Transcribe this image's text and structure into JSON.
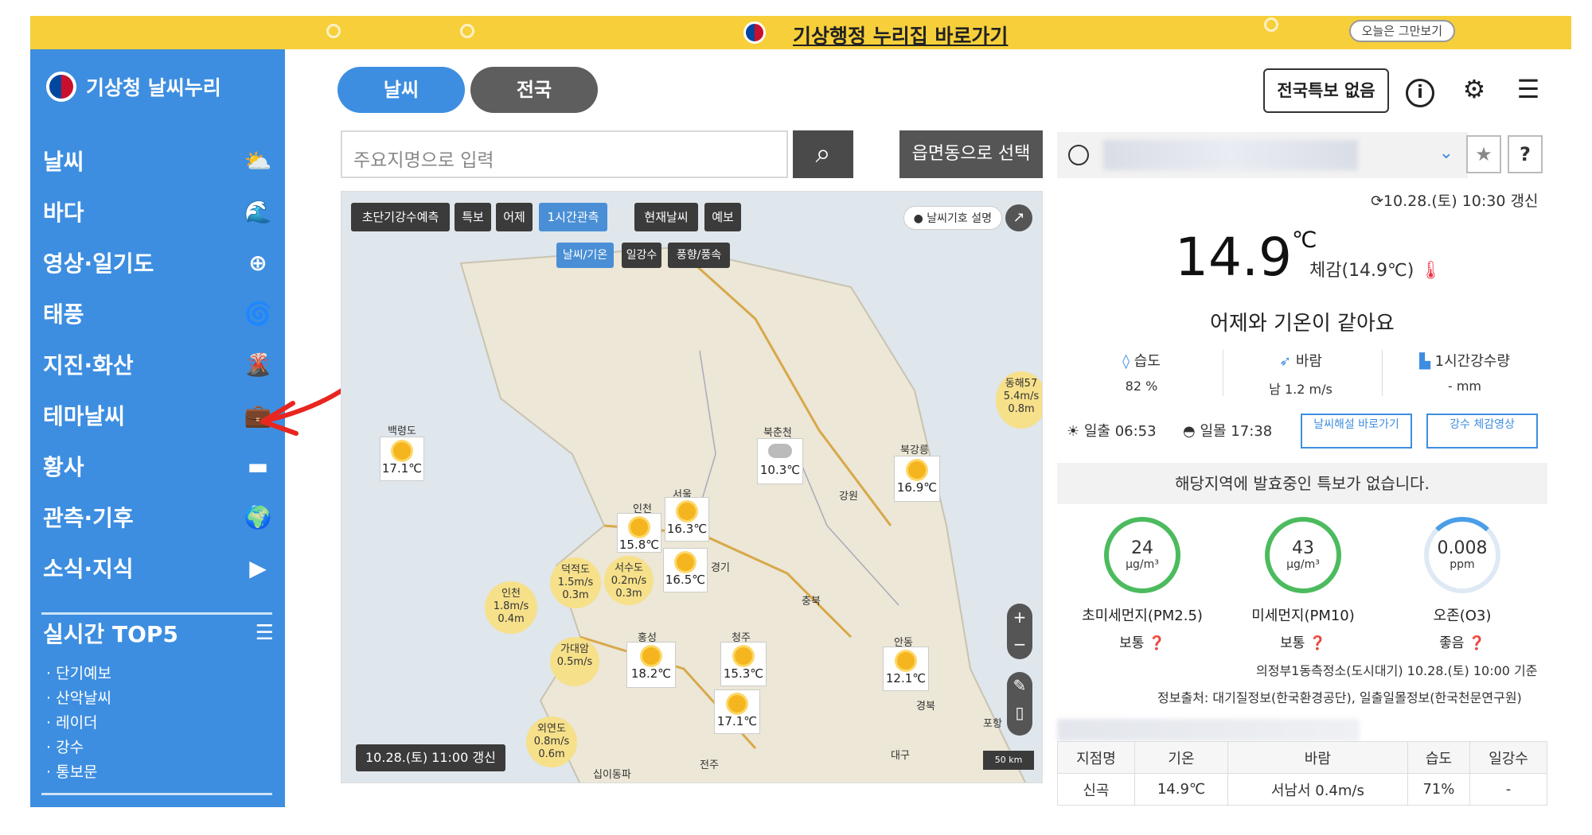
{
  "banner": {
    "title": "기상행정 누리집 바로가기",
    "hide_today": "오늘은 그만보기"
  },
  "sidebar": {
    "brand": "기상청 날씨누리",
    "items": [
      {
        "label": "날씨",
        "icon": "weather-icon",
        "glyph": "⛅"
      },
      {
        "label": "바다",
        "icon": "wave-icon",
        "glyph": "🌊"
      },
      {
        "label": "영상·일기도",
        "icon": "satellite-icon",
        "glyph": "⊕"
      },
      {
        "label": "태풍",
        "icon": "typhoon-icon",
        "glyph": "🌀"
      },
      {
        "label": "지진·화산",
        "icon": "volcano-icon",
        "glyph": "🌋"
      },
      {
        "label": "테마날씨",
        "icon": "briefcase-icon",
        "glyph": "💼"
      },
      {
        "label": "황사",
        "icon": "dust-icon",
        "glyph": "▬"
      },
      {
        "label": "관측·기후",
        "icon": "globe-icon",
        "glyph": "🌍"
      },
      {
        "label": "소식·지식",
        "icon": "play-icon",
        "glyph": "▶"
      }
    ],
    "top5": {
      "label": "실시간 TOP5",
      "items": [
        "단기예보",
        "산악날씨",
        "레이더",
        "강수",
        "통보문"
      ]
    }
  },
  "tabs": {
    "weather": "날씨",
    "nation": "전국"
  },
  "search": {
    "placeholder": "주요지명으로 입력",
    "eup_button": "읍면동으로 선택"
  },
  "map": {
    "chips": [
      "초단기강수예측",
      "특보",
      "어제",
      "1시간관측",
      "현재날씨",
      "예보"
    ],
    "active_chip": "1시간관측",
    "sub_chips": [
      "날씨/기온",
      "일강수",
      "풍향/풍속"
    ],
    "legend_button": "날씨기호 설명",
    "update_time": "10.28.(토) 11:00 갱신",
    "scale": "50 km",
    "stations": [
      {
        "name": "백령도",
        "temp": "17.1℃"
      },
      {
        "name": "북춘천",
        "temp": "10.3℃"
      },
      {
        "name": "북강릉",
        "temp": "16.9℃"
      },
      {
        "name": "서울",
        "temp": "16.3℃"
      },
      {
        "name": "인천",
        "temp": "15.8℃"
      },
      {
        "name": "서수도",
        "temp": "16.5℃"
      },
      {
        "name": "홍성",
        "temp": "18.2℃"
      },
      {
        "name": "청주",
        "temp": "15.3℃"
      },
      {
        "name": "",
        "temp": "17.1℃"
      },
      {
        "name": "안동",
        "temp": "12.1℃"
      }
    ],
    "waves": [
      {
        "name": "인천",
        "line1": "1.8m/s",
        "line2": "0.4m"
      },
      {
        "name": "덕적도",
        "line1": "1.5m/s",
        "line2": "0.3m"
      },
      {
        "name": "서수도",
        "line1": "0.2m/s",
        "line2": "0.3m"
      },
      {
        "name": "가대암",
        "line1": "0.5m/s",
        "line2": ""
      },
      {
        "name": "외연도",
        "line1": "0.8m/s",
        "line2": "0.6m"
      },
      {
        "name": "동해57",
        "line1": "5.4m/s",
        "line2": "0.8m"
      }
    ],
    "labels": [
      "경기",
      "강원",
      "충북",
      "경북",
      "전주",
      "대구",
      "포항",
      "십이동파"
    ]
  },
  "header_right": {
    "warning_button": "전국특보 없음"
  },
  "panel": {
    "update": "10.28.(토) 10:30 갱신",
    "temperature": "14.9",
    "temp_unit": "℃",
    "feels_like": "체감(14.9℃)",
    "compare": "어제와 기온이 같아요",
    "humidity": {
      "label": "습도",
      "value": "82 %"
    },
    "wind": {
      "label": "바람",
      "value": "남 1.2 m/s"
    },
    "rain": {
      "label": "1시간강수량",
      "value": "- mm"
    },
    "sunrise": "일출  06:53",
    "sunset": "일몰  17:38",
    "btn_commentary": "날씨해설 바로가기",
    "btn_rain_video": "강수 체감영상",
    "notice": "해당지역에 발효중인 특보가 없습니다.",
    "pm25": {
      "value": "24",
      "unit": "μg/m³",
      "name": "초미세먼지(PM2.5)",
      "grade": "보통"
    },
    "pm10": {
      "value": "43",
      "unit": "μg/m³",
      "name": "미세먼지(PM10)",
      "grade": "보통"
    },
    "ozone": {
      "value": "0.008",
      "unit": "ppm",
      "name": "오존(O3)",
      "grade": "좋음"
    },
    "source1": "의정부1동측정소(도시대기) 10.28.(토) 10:00 기준",
    "source2": "정보출처: 대기질정보(한국환경공단), 일출일몰정보(한국천문연구원)",
    "table": {
      "headers": [
        "지점명",
        "기온",
        "바람",
        "습도",
        "일강수"
      ],
      "row": [
        "신곡",
        "14.9℃",
        "서남서 0.4m/s",
        "71%",
        "-"
      ]
    }
  },
  "colors": {
    "sidebar": "#3d8ee0",
    "banner": "#f7cf3b",
    "good_ring": "#4cbb5e",
    "ozone_ring": "#4a9ee8"
  }
}
